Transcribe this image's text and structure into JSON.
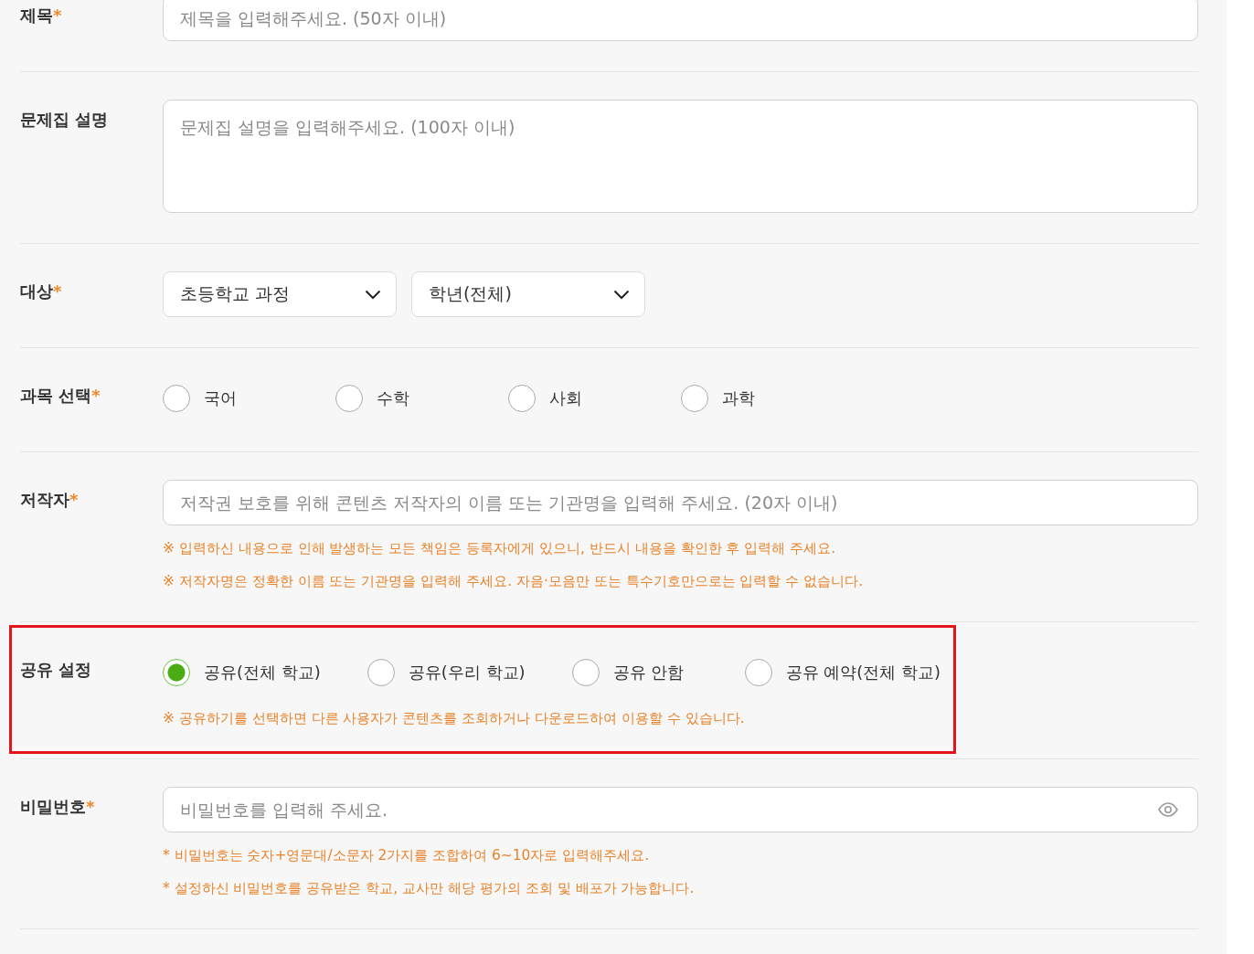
{
  "form": {
    "sections": [
      {
        "kind": "text",
        "label": "제목",
        "required_mark": "*",
        "highlighted": false,
        "field": {
          "placeholder": "제목을 입력해주세요. (50자 이내)"
        }
      },
      {
        "kind": "textarea",
        "label": "문제집 설명",
        "highlighted": false,
        "field": {
          "placeholder": "문제집 설명을 입력해주세요. (100자 이내)"
        }
      },
      {
        "kind": "selects",
        "label": "대상",
        "required_mark": "*",
        "highlighted": false,
        "selects": [
          {
            "value": "초등학교 과정"
          },
          {
            "value": "학년(전체)"
          }
        ]
      },
      {
        "kind": "radios",
        "label": "과목 선택",
        "required_mark": "*",
        "highlighted": false,
        "options": [
          {
            "label": "국어",
            "selected": false
          },
          {
            "label": "수학",
            "selected": false
          },
          {
            "label": "사회",
            "selected": false
          },
          {
            "label": "과학",
            "selected": false
          }
        ]
      },
      {
        "kind": "text",
        "label": "저작자",
        "required_mark": "*",
        "highlighted": false,
        "field": {
          "placeholder": "저작권 보호를 위해 콘텐츠 저작자의 이름 또는 기관명을 입력해 주세요. (20자 이내)"
        },
        "notes": [
          "※ 입력하신 내용으로 인해 발생하는 모든 책임은 등록자에게 있으니, 반드시 내용을 확인한 후 입력해 주세요.",
          "※ 저작자명은 정확한 이름 또는 기관명을 입력해 주세요. 자음·모음만 또는 특수기호만으로는 입력할 수 없습니다."
        ]
      },
      {
        "kind": "radios",
        "label": "공유 설정",
        "highlighted": true,
        "options": [
          {
            "label": "공유(전체 학교)",
            "selected": true
          },
          {
            "label": "공유(우리 학교)",
            "selected": false
          },
          {
            "label": "공유 안함",
            "selected": false
          },
          {
            "label": "공유 예약(전체 학교)",
            "selected": false
          }
        ],
        "notes": [
          "※ 공유하기를 선택하면 다른 사용자가 콘텐츠를 조회하거나 다운로드하여 이용할 수 있습니다."
        ]
      },
      {
        "kind": "password",
        "label": "비밀번호",
        "required_mark": "*",
        "highlighted": false,
        "field": {
          "placeholder": "비밀번호를 입력해 주세요."
        },
        "notes": [
          "* 비밀번호는 숫자+영문대/소문자 2가지를 조합하여 6~10자로 입력해주세요.",
          "* 설정하신 비밀번호를 공유받은 학교, 교사만 해당 평가의 조회 및 배포가 가능합니다."
        ]
      }
    ]
  }
}
